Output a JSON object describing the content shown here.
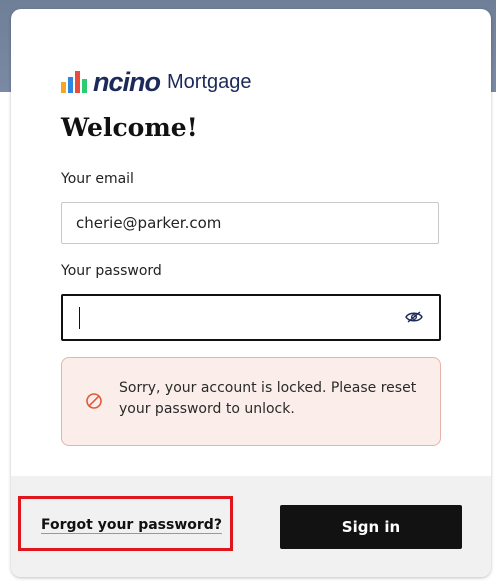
{
  "brand": {
    "logo_word": "ncino",
    "product": "Mortgage",
    "bar_colors": [
      "#f5a623",
      "#2e86de",
      "#e74c3c",
      "#2ecc71"
    ]
  },
  "form": {
    "title": "Welcome!",
    "email_label": "Your email",
    "email_value": "cherie@parker.com",
    "password_label": "Your password",
    "password_value": "",
    "password_toggle_icon": "eye-slash-icon"
  },
  "alert": {
    "icon": "ban-circle-icon",
    "message": "Sorry, your account is locked. Please reset your password to unlock.",
    "color": "#e05a3a",
    "background": "#fbeeea"
  },
  "footer": {
    "forgot_label": "Forgot your password?",
    "signin_label": "Sign in"
  },
  "annotation": {
    "highlight_color": "#e0161d"
  }
}
